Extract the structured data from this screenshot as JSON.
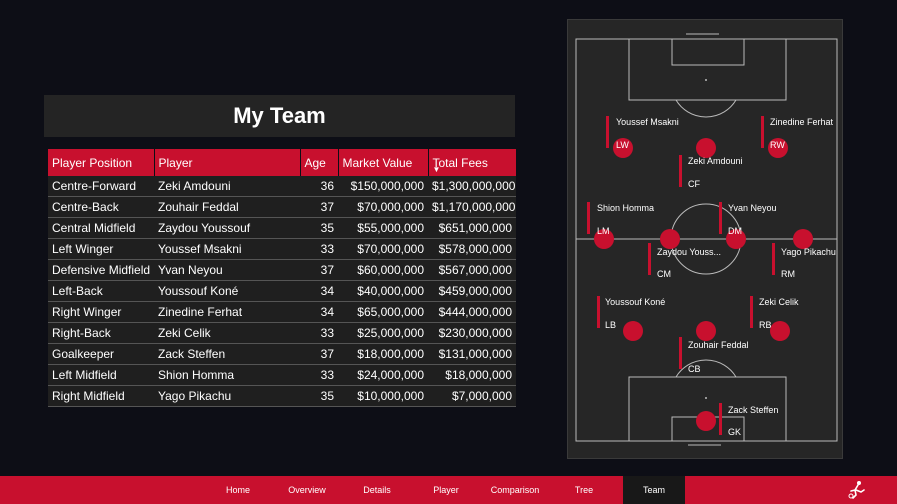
{
  "title": "My Team",
  "table": {
    "headers": [
      "Player Position",
      "Player",
      "Age",
      "Market Value",
      "Total Fees"
    ],
    "sorted_column": "Total Fees",
    "rows": [
      [
        "Centre-Forward",
        "Zeki Amdouni",
        "36",
        "$150,000,000",
        "$1,300,000,000"
      ],
      [
        "Centre-Back",
        "Zouhair Feddal",
        "37",
        "$70,000,000",
        "$1,170,000,000"
      ],
      [
        "Central Midfield",
        "Zaydou Youssouf",
        "35",
        "$55,000,000",
        "$651,000,000"
      ],
      [
        "Left Winger",
        "Youssef Msakni",
        "33",
        "$70,000,000",
        "$578,000,000"
      ],
      [
        "Defensive Midfield",
        "Yvan Neyou",
        "37",
        "$60,000,000",
        "$567,000,000"
      ],
      [
        "Left-Back",
        "Youssouf Koné",
        "34",
        "$40,000,000",
        "$459,000,000"
      ],
      [
        "Right Winger",
        "Zinedine Ferhat",
        "34",
        "$65,000,000",
        "$444,000,000"
      ],
      [
        "Right-Back",
        "Zeki Celik",
        "33",
        "$25,000,000",
        "$230,000,000"
      ],
      [
        "Goalkeeper",
        "Zack Steffen",
        "37",
        "$18,000,000",
        "$131,000,000"
      ],
      [
        "Left Midfield",
        "Shion Homma",
        "33",
        "$24,000,000",
        "$18,000,000"
      ],
      [
        "Right Midfield",
        "Yago Pikachu",
        "35",
        "$10,000,000",
        "$7,000,000"
      ]
    ]
  },
  "pitch": {
    "players": [
      {
        "name": "Youssef Msakni",
        "pos": "LW"
      },
      {
        "name": "Zinedine Ferhat",
        "pos": "RW"
      },
      {
        "name": "Zeki Amdouni",
        "pos": "CF"
      },
      {
        "name": "Shion Homma",
        "pos": "LM"
      },
      {
        "name": "Yvan Neyou",
        "pos": "DM"
      },
      {
        "name": "Zaydou Youss...",
        "pos": "CM"
      },
      {
        "name": "Yago Pikachu",
        "pos": "RM"
      },
      {
        "name": "Youssouf Koné",
        "pos": "LB"
      },
      {
        "name": "Zeki Celik",
        "pos": "RB"
      },
      {
        "name": "Zouhair Feddal",
        "pos": "CB"
      },
      {
        "name": "Zack Steffen",
        "pos": "GK"
      }
    ]
  },
  "nav": {
    "items": [
      "Home",
      "Overview",
      "Details",
      "Player",
      "Comparison",
      "Tree",
      "Team"
    ],
    "active": "Team"
  },
  "colors": {
    "accent": "#c8102e",
    "background": "#0d0e16",
    "panel": "#242424",
    "pitch": "#262626",
    "pitch_lines": "#bbbbbb"
  },
  "icons": {
    "logo": "soccer-player-icon",
    "sort": "sort-descending-icon"
  }
}
